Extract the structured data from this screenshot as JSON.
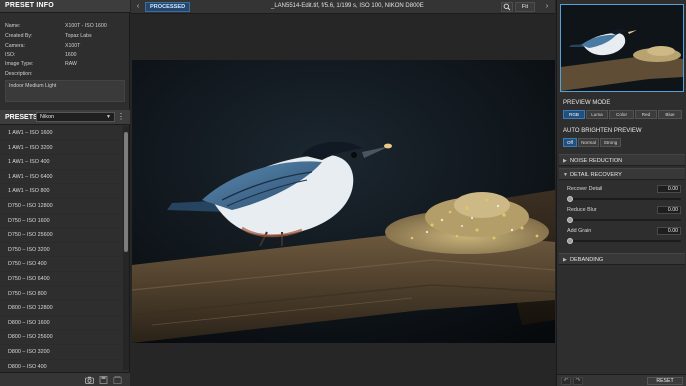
{
  "preset_info": {
    "title": "PRESET INFO",
    "rows": [
      {
        "key": "Name:",
        "value": "X100T - ISO 1600"
      },
      {
        "key": "Created By:",
        "value": "Topaz Labs"
      },
      {
        "key": "Camera:",
        "value": "X100T"
      },
      {
        "key": "ISO:",
        "value": "1600"
      },
      {
        "key": "Image Type:",
        "value": "RAW"
      },
      {
        "key": "Description:",
        "value": ""
      }
    ],
    "description": "Indoor Medium Light"
  },
  "presets": {
    "title": "PRESETS",
    "selected_camera": "Nikon",
    "items": [
      "1 AW1 – ISO 1600",
      "1 AW1 – ISO 3200",
      "1 AW1 – ISO 400",
      "1 AW1 – ISO 6400",
      "1 AW1 – ISO 800",
      "D750 – ISO 12800",
      "D750 – ISO 1600",
      "D750 – ISO 25600",
      "D750 – ISO 3200",
      "D750 – ISO 400",
      "D750 – ISO 6400",
      "D750 – ISO 800",
      "D800 – ISO 12800",
      "D800 – ISO 1600",
      "D800 – ISO 25600",
      "D800 – ISO 3200",
      "D800 – ISO 400"
    ]
  },
  "topbar": {
    "view_label": "PROCESSED",
    "file_title": "_LAN5514-Edit.tif, f/5.6, 1/199 s, ISO 100, NIKON D800E",
    "fit_label": "Fit"
  },
  "right": {
    "preview_mode_title": "PREVIEW MODE",
    "preview_modes": [
      "RGB",
      "Luma",
      "Color",
      "Red",
      "Blue"
    ],
    "preview_mode_active": "RGB",
    "auto_brighten_title": "AUTO BRIGHTEN PREVIEW",
    "auto_brighten_options": [
      "Off",
      "Normal",
      "Strong"
    ],
    "auto_brighten_active": "Off",
    "noise_reduction": "NOISE REDUCTION",
    "detail_recovery": "DETAIL RECOVERY",
    "sliders": [
      {
        "label": "Recover Detail",
        "value": "0.00",
        "level": 0
      },
      {
        "label": "Reduce Blur",
        "value": "0.00",
        "level": 0
      },
      {
        "label": "Add Grain",
        "value": "0.00",
        "level": 0
      }
    ],
    "debanding": "DEBANDING",
    "reset_label": "RESET"
  },
  "colors": {
    "accent": "#21507f",
    "panel": "#2e2e2e",
    "header": "#3d3d3d"
  },
  "icons": {
    "prev_image": "chevron-left-icon",
    "next_image": "chevron-right-icon",
    "zoom": "search-icon",
    "camera": "camera-icon",
    "save": "save-preset-icon",
    "import": "import-icon",
    "undo": "undo-icon",
    "redo": "redo-icon"
  }
}
